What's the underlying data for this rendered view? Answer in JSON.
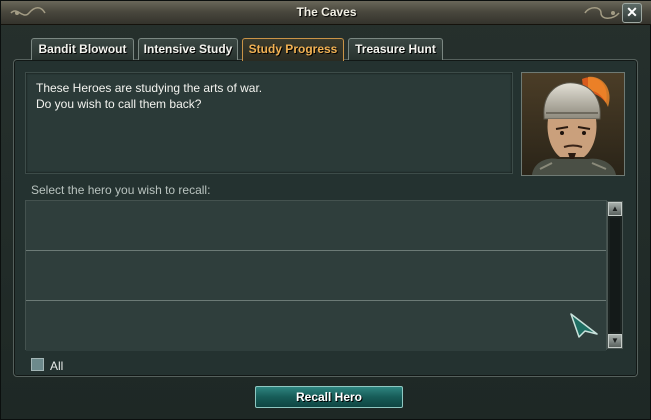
{
  "window": {
    "title": "The Caves",
    "close_glyph": "✕"
  },
  "tabs": [
    {
      "label": "Bandit Blowout",
      "active": false
    },
    {
      "label": "Intensive Study",
      "active": false
    },
    {
      "label": "Study Progress",
      "active": true
    },
    {
      "label": "Treasure Hunt",
      "active": false
    }
  ],
  "message": {
    "line1": "These Heroes are studying the arts of war.",
    "line2": "Do you wish to call them back?"
  },
  "portrait": {
    "icon": "hero-portrait-helmeted-general"
  },
  "hero_list": {
    "label": "Select the hero you wish to recall:",
    "rows": [
      "",
      "",
      ""
    ]
  },
  "scrollbar": {
    "up_glyph": "▲",
    "down_glyph": "▼"
  },
  "select_all": {
    "label": "All",
    "checked": false
  },
  "actions": {
    "recall_label": "Recall Hero"
  },
  "colors": {
    "active_tab": "#f1b153",
    "recall_button": "#175c58",
    "panel": "#2b3a38"
  }
}
